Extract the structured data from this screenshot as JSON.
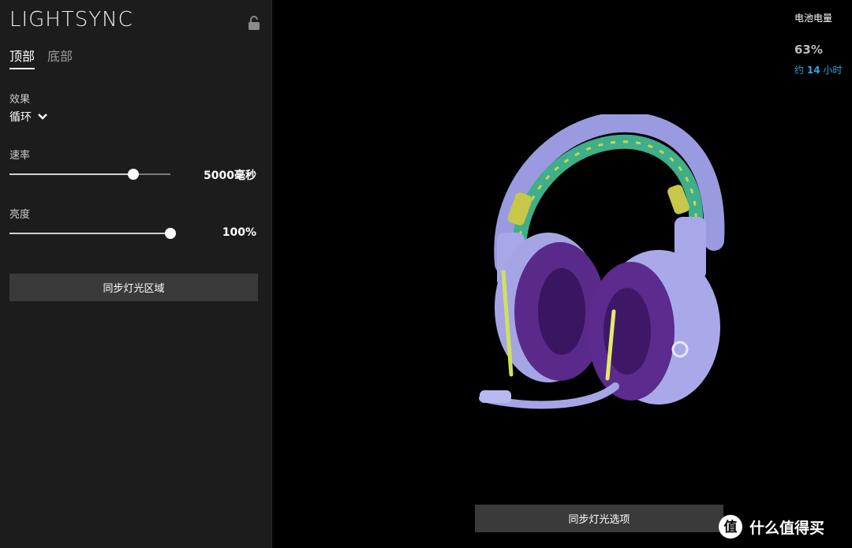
{
  "panel": {
    "title": "LIGHTSYNC",
    "tabs": [
      {
        "label": "顶部",
        "active": true
      },
      {
        "label": "底部",
        "active": false
      }
    ],
    "effect": {
      "label": "效果",
      "value": "循环"
    },
    "speed": {
      "label": "速率",
      "value_text": "5000毫秒",
      "level": 0.77
    },
    "brightness": {
      "label": "亮度",
      "value_text": "100%",
      "level": 1.0
    },
    "sync_zones_button": "同步灯光区域"
  },
  "battery": {
    "label": "电池电量",
    "percent": "63%",
    "time_prefix": "约",
    "time_value": "14",
    "time_unit": "小时"
  },
  "sync_options_button": "同步灯光选项",
  "watermark": {
    "text": "什么值得买",
    "logo": "值"
  }
}
